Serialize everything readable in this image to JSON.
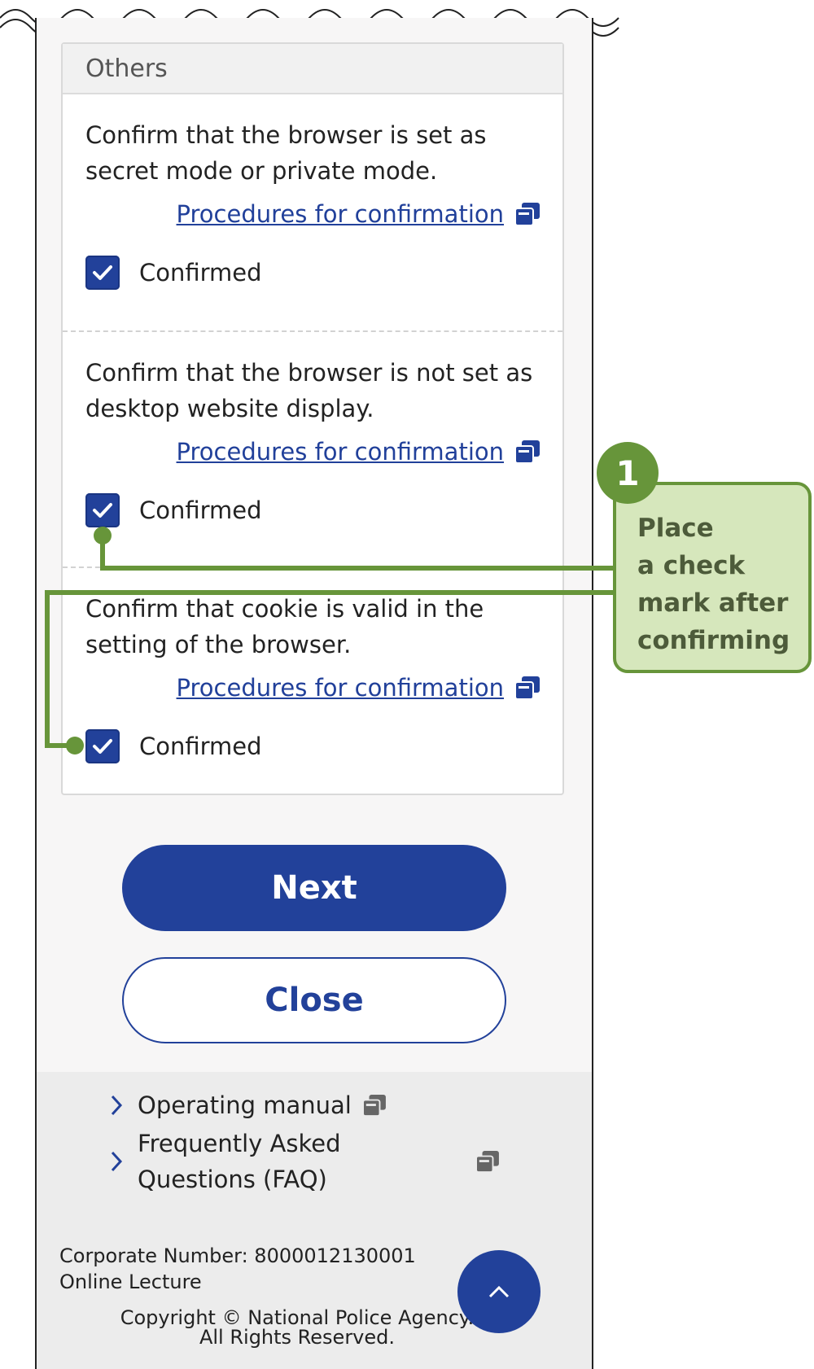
{
  "others_section": {
    "title": "Others",
    "items": [
      {
        "description": "Confirm that the browser is set as secret mode or private mode.",
        "link": "Procedures for confirmation",
        "check_label": "Confirmed",
        "checked": true
      },
      {
        "description": "Confirm that the browser is not set as desktop website display.",
        "link": "Procedures for confirmation",
        "check_label": "Confirmed",
        "checked": true
      },
      {
        "description": "Confirm that cookie is valid in the setting of the browser.",
        "link": "Procedures for confirmation",
        "check_label": "Confirmed",
        "checked": true
      }
    ]
  },
  "buttons": {
    "next": "Next",
    "close": "Close"
  },
  "footer": {
    "links": [
      {
        "label": "Operating manual"
      },
      {
        "label": "Frequently Asked Questions (FAQ)"
      }
    ],
    "corporate_number": "Corporate Number: 8000012130001",
    "site_name": "Online Lecture",
    "copyright_line1": "Copyright © National Police Agency.",
    "copyright_line2": "All Rights Reserved."
  },
  "callout": {
    "number": "1",
    "text": "Place\na check\nmark after\nconfirming"
  },
  "colors": {
    "primary": "#22419a",
    "callout_green": "#67953a",
    "callout_fill": "#d6e7bc"
  }
}
